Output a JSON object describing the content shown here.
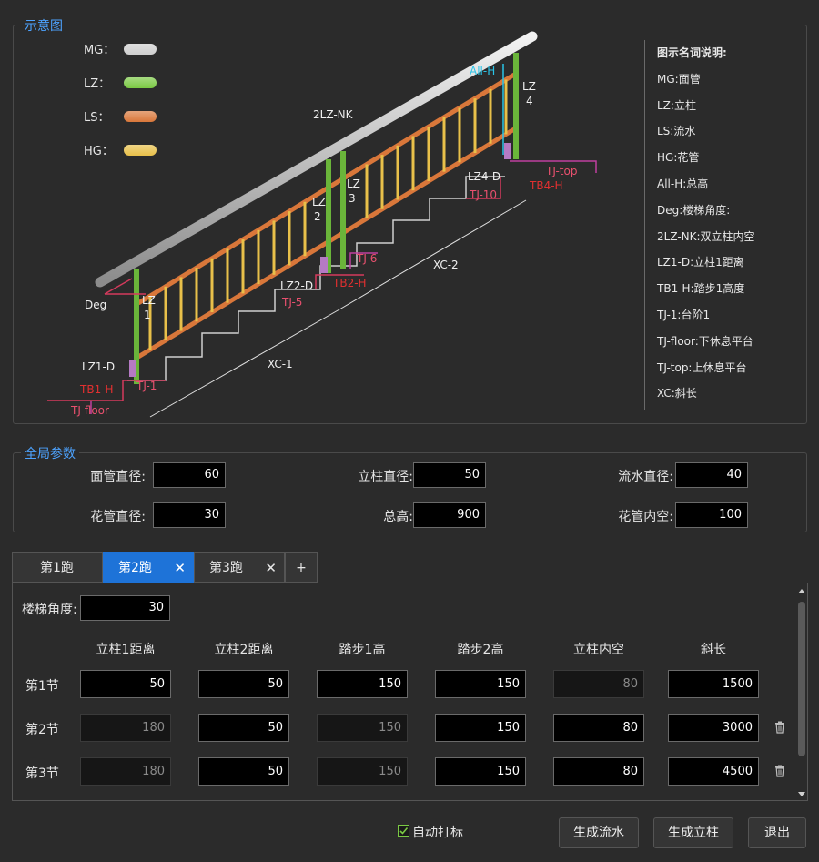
{
  "diagram_group": {
    "title": "示意图"
  },
  "legend": [
    {
      "label": "MG：",
      "color": "#cfcfcf"
    },
    {
      "label": "LZ：",
      "color": "#7ac943"
    },
    {
      "label": "LS：",
      "color": "#d9773a"
    },
    {
      "label": "HG：",
      "color": "#e8c04a"
    }
  ],
  "diagram_labels": {
    "lz4": "LZ",
    "lz4n": "4",
    "allh": "All-H",
    "lz2nk": "2LZ-NK",
    "lz2": "LZ",
    "lz2n": "2",
    "lz3": "LZ",
    "lz3n": "3",
    "lz1": "LZ",
    "lz1n": "1",
    "lz4d": "LZ4-D",
    "tjtop": "TJ-top",
    "tj10": "TJ-10",
    "tb4h": "TB4-H",
    "tj6": "TJ-6",
    "xc2": "XC-2",
    "lz2d": "LZ2-D",
    "tb2h": "TB2-H",
    "tj5": "TJ-5",
    "deg": "Deg",
    "lz1d": "LZ1-D",
    "xc1": "XC-1",
    "tb1h": "TB1-H",
    "tj1": "TJ-1",
    "tjfloor": "TJ-floor"
  },
  "description": {
    "header": "图示名词说明:",
    "items": [
      "MG:面管",
      "LZ:立柱",
      "LS:流水",
      "HG:花管",
      "All-H:总高",
      "Deg:楼梯角度:",
      "2LZ-NK:双立柱内空",
      "LZ1-D:立柱1距离",
      "TB1-H:踏步1高度",
      "TJ-1:台阶1",
      "TJ-floor:下休息平台",
      "TJ-top:上休息平台",
      "XC:斜长"
    ]
  },
  "global_params": {
    "title": "全局参数",
    "fields": [
      {
        "label": "面管直径:",
        "value": "60"
      },
      {
        "label": "立柱直径:",
        "value": "50"
      },
      {
        "label": "流水直径:",
        "value": "40"
      },
      {
        "label": "花管直径:",
        "value": "30"
      },
      {
        "label": "总高:",
        "value": "900"
      },
      {
        "label": "花管内空:",
        "value": "100"
      }
    ]
  },
  "tabs": [
    {
      "label": "第1跑",
      "close": ""
    },
    {
      "label": "第2跑",
      "close": "✕"
    },
    {
      "label": "第3跑",
      "close": "✕"
    }
  ],
  "add_tab": "+",
  "run": {
    "angle_label": "楼梯角度:",
    "angle_value": "30",
    "columns": [
      "立柱1距离",
      "立柱2距离",
      "踏步1高",
      "踏步2高",
      "立柱内空",
      "斜长"
    ],
    "rows": [
      {
        "label": "第1节",
        "cells": [
          "50",
          "50",
          "150",
          "150",
          "80",
          "1500"
        ]
      },
      {
        "label": "第2节",
        "cells": [
          "180",
          "50",
          "150",
          "150",
          "80",
          "3000"
        ]
      },
      {
        "label": "第3节",
        "cells": [
          "180",
          "50",
          "150",
          "150",
          "80",
          "4500"
        ]
      }
    ]
  },
  "footer": {
    "auto_mark_label": "自动打标",
    "auto_mark_checked": true,
    "btn_gen_ls": "生成流水",
    "btn_gen_lz": "生成立柱",
    "btn_exit": "退出"
  }
}
